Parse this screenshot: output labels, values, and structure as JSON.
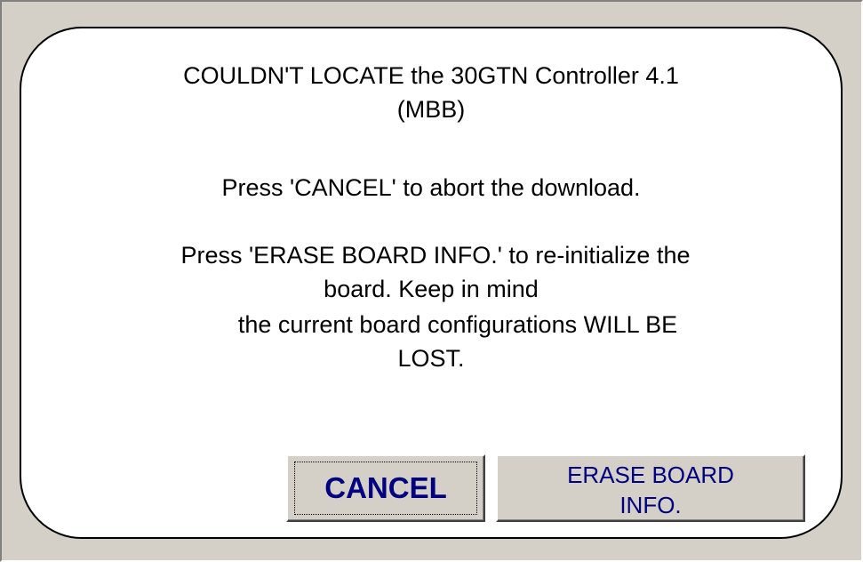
{
  "dialog": {
    "lines": [
      "COULDN'T LOCATE the 30GTN Controller 4.1",
      "(MBB)",
      "Press 'CANCEL' to abort the download.",
      "Press 'ERASE BOARD INFO.' to re-initialize the",
      "board. Keep in mind",
      "the current board configurations WILL BE",
      "LOST."
    ]
  },
  "buttons": {
    "cancel_label": "CANCEL",
    "erase_label_line1": "ERASE BOARD",
    "erase_label_line2": "INFO."
  },
  "colors": {
    "window_bg": "#d4d0c8",
    "panel_bg": "#ffffff",
    "button_text": "#000080"
  }
}
